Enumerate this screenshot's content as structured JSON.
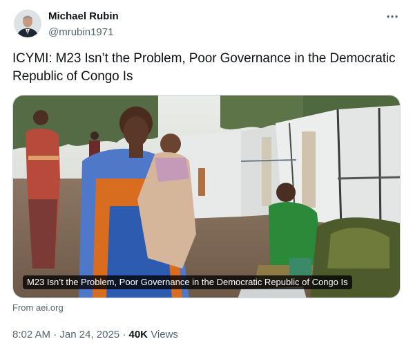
{
  "author": {
    "display_name": "Michael Rubin",
    "handle": "@mrubin1971"
  },
  "icons": {
    "avatar": "avatar-photo",
    "more": "more-icon"
  },
  "tweet": {
    "text": "ICYMI: M23 Isn’t the Problem, Poor Governance in the Democratic Republic of Congo Is"
  },
  "card": {
    "caption": "M23 Isn’t the Problem, Poor Governance in the Democratic Republic of Congo Is",
    "source": "From aei.org"
  },
  "meta": {
    "time": "8:02 AM",
    "separator": "·",
    "date": "Jan 24, 2025",
    "views_count": "40K",
    "views_label": "Views"
  },
  "colors": {
    "text": "#0f1419",
    "secondary": "#536471",
    "border": "#cfd9de"
  }
}
